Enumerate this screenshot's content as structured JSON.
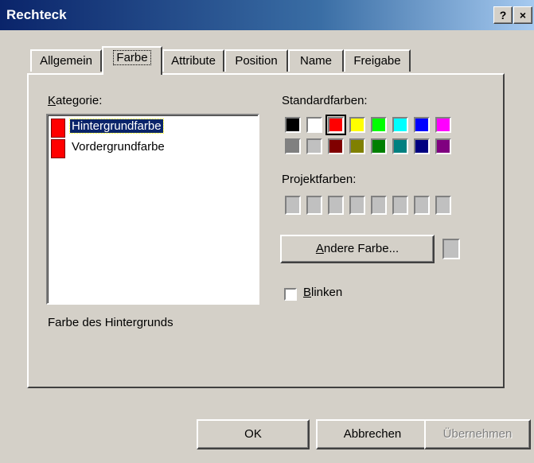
{
  "window": {
    "title": "Rechteck",
    "help_label": "?",
    "close_label": "×"
  },
  "tabs": [
    {
      "label": "Allgemein"
    },
    {
      "label": "Farbe"
    },
    {
      "label": "Attribute"
    },
    {
      "label": "Position"
    },
    {
      "label": "Name"
    },
    {
      "label": "Freigabe"
    }
  ],
  "category": {
    "label_first": "K",
    "label_rest": "ategorie:",
    "items": [
      {
        "label": "Hintergrundfarbe",
        "color": "#ff0000",
        "selected": true
      },
      {
        "label": "Vordergrundfarbe",
        "color": "#ff0000",
        "selected": false
      }
    ],
    "description": "Farbe des Hintergrunds"
  },
  "standard_colors": {
    "label": "Standardfarben:",
    "colors": [
      "#000000",
      "#ffffff",
      "#ff0000",
      "#ffff00",
      "#00ff00",
      "#00ffff",
      "#0000ff",
      "#ff00ff",
      "#808080",
      "#c0c0c0",
      "#800000",
      "#808000",
      "#008000",
      "#008080",
      "#000080",
      "#800080"
    ],
    "selected_index": 2
  },
  "project_colors": {
    "label": "Projektfarben:",
    "count": 8
  },
  "other_color_button": {
    "label_first": "A",
    "label_rest": "ndere Farbe..."
  },
  "blink": {
    "label_first": "B",
    "label_rest": "linken",
    "checked": false
  },
  "footer": {
    "ok_label": "OK",
    "cancel_label": "Abbrechen",
    "apply_label": "Übernehmen"
  }
}
